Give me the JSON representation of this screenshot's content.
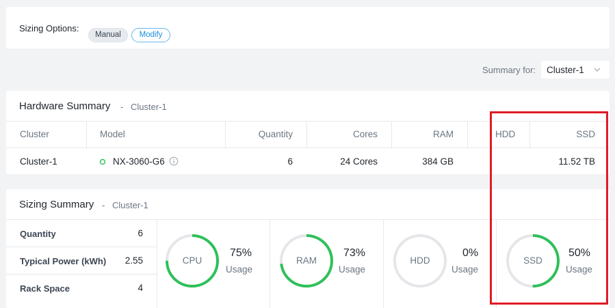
{
  "sizing_options": {
    "label": "Sizing Options:",
    "buttons": [
      {
        "label": "Manual"
      },
      {
        "label": "Modify"
      }
    ]
  },
  "summary_for": {
    "label": "Summary for:",
    "selected": "Cluster-1",
    "icon": "chevron-down-icon"
  },
  "hardware_summary": {
    "title": "Hardware Summary",
    "separator": "-",
    "cluster": "Cluster-1",
    "columns": [
      "Cluster",
      "Model",
      "Quantity",
      "Cores",
      "RAM",
      "HDD",
      "SSD"
    ],
    "rows": [
      {
        "cluster": "Cluster-1",
        "model": "NX-3060-G6",
        "quantity": "6",
        "cores": "24 Cores",
        "ram": "384 GB",
        "hdd": "",
        "ssd": "11.52 TB"
      }
    ]
  },
  "sizing_summary": {
    "title": "Sizing Summary",
    "separator": "-",
    "cluster": "Cluster-1",
    "stats": [
      {
        "label": "Quantity",
        "value": "6"
      },
      {
        "label": "Typical Power (kWh)",
        "value": "2.55"
      },
      {
        "label": "Rack Space",
        "value": "4"
      }
    ],
    "gauges": [
      {
        "name": "CPU",
        "percent": "75%",
        "usage_label": "Usage",
        "fraction": 0.75
      },
      {
        "name": "RAM",
        "percent": "73%",
        "usage_label": "Usage",
        "fraction": 0.73
      },
      {
        "name": "HDD",
        "percent": "0%",
        "usage_label": "Usage",
        "fraction": 0
      },
      {
        "name": "SSD",
        "percent": "50%",
        "usage_label": "Usage",
        "fraction": 0.5
      }
    ]
  },
  "colors": {
    "accent": "#1a8ee0",
    "gauge_fill": "#2ec05a",
    "gauge_track": "#e4e6e9",
    "status_ok": "#2ec05a",
    "highlight": "#e01b24"
  }
}
